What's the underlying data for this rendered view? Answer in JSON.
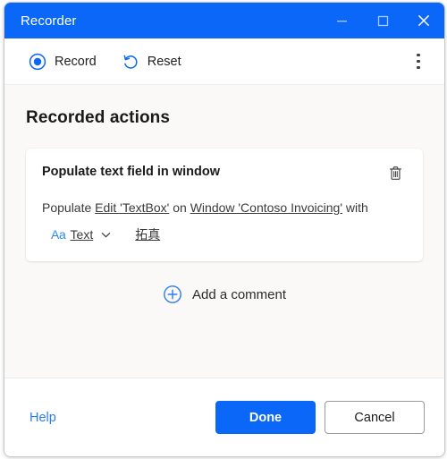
{
  "window": {
    "title": "Recorder",
    "controls": {
      "minimize": "minimize-icon",
      "maximize": "maximize-icon",
      "close": "close-icon"
    }
  },
  "toolbar": {
    "record_label": "Record",
    "record_icon": "record-circle-icon",
    "reset_label": "Reset",
    "reset_icon": "reset-arrow-icon",
    "overflow_icon": "more-vertical-icon"
  },
  "main": {
    "section_title": "Recorded actions",
    "action_card": {
      "title": "Populate text field in window",
      "delete_icon": "trash-icon",
      "sentence": {
        "lead": "Populate",
        "target": "Edit 'TextBox'",
        "connector": "on",
        "window": "Window 'Contoso Invoicing'",
        "tail": "with"
      },
      "parameter": {
        "type_icon": "text-format-icon",
        "type_icon_label": "Aa",
        "type_label": "Text",
        "dropdown_icon": "chevron-down-icon",
        "value": "拓真"
      }
    },
    "add_comment": {
      "label": "Add a comment",
      "icon": "add-circle-icon"
    }
  },
  "footer": {
    "help_label": "Help",
    "done_label": "Done",
    "cancel_label": "Cancel"
  },
  "colors": {
    "accent_blue": "#0a67f8",
    "link_blue": "#2b7cf0",
    "icon_blue": "#2b88f0",
    "page_background": "#faf9f8",
    "card_background": "#ffffff",
    "text_primary": "#1b1a19",
    "text_secondary": "#3b3a39"
  }
}
